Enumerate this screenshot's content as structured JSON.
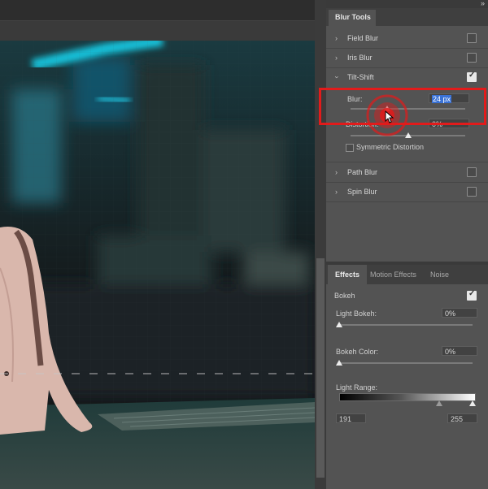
{
  "panel": {
    "title": "Blur Tools",
    "collapse_glyph": "»",
    "blur_tools": [
      {
        "label": "Field Blur",
        "expanded": false,
        "checked": false
      },
      {
        "label": "Iris Blur",
        "expanded": false,
        "checked": false
      },
      {
        "label": "Tilt-Shift",
        "expanded": true,
        "checked": true
      },
      {
        "label": "Path Blur",
        "expanded": false,
        "checked": false
      },
      {
        "label": "Spin Blur",
        "expanded": false,
        "checked": false
      }
    ],
    "tilt_shift": {
      "blur_label": "Blur:",
      "blur_value": "24 px",
      "blur_slider_fraction": 0.32,
      "distortion_label": "Distortion:",
      "distortion_value": "0%",
      "distortion_slider_fraction": 0.5,
      "symmetric_label": "Symmetric Distortion",
      "symmetric_checked": false
    }
  },
  "effects_panel": {
    "tabs": [
      "Effects",
      "Motion Effects",
      "Noise"
    ],
    "active_tab": "Effects",
    "bokeh_label": "Bokeh",
    "bokeh_checked": true,
    "light_bokeh_label": "Light Bokeh:",
    "light_bokeh_value": "0%",
    "bokeh_color_label": "Bokeh Color:",
    "bokeh_color_value": "0%",
    "light_range_label": "Light Range:",
    "light_range_low": "191",
    "light_range_high": "255"
  },
  "colors": {
    "highlight_red": "#e21b1b",
    "selection_blue": "#3a72d6"
  }
}
